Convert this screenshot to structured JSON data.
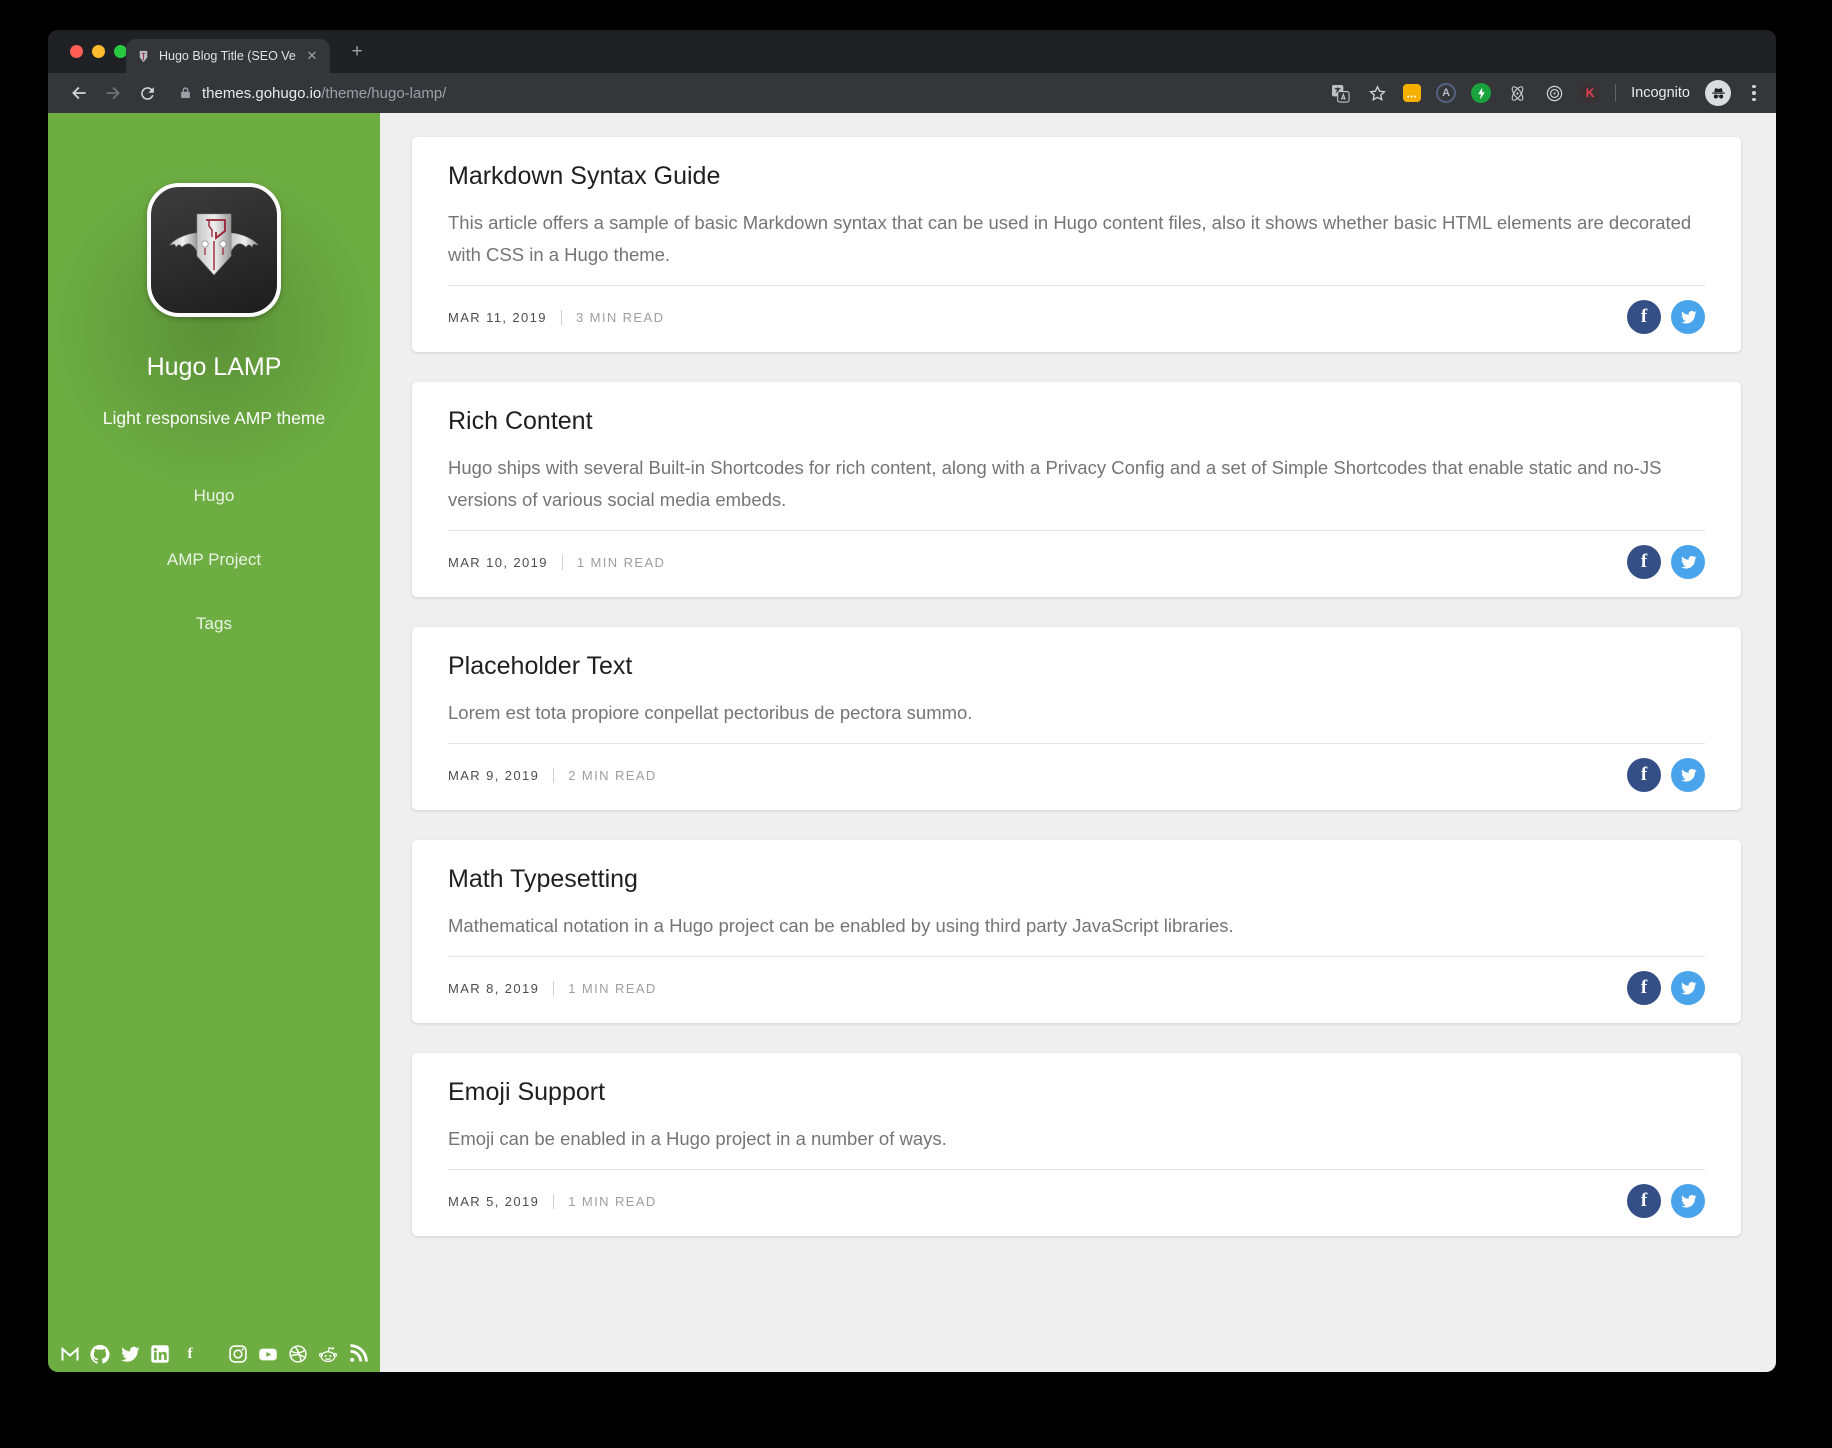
{
  "browser": {
    "tab_title": "Hugo Blog Title (SEO Version)",
    "url_host": "themes.gohugo.io",
    "url_path": "/theme/hugo-lamp/",
    "incognito_label": "Incognito",
    "extension_a_label": "A",
    "extension_k_label": "K"
  },
  "sidebar": {
    "title": "Hugo LAMP",
    "tagline": "Light responsive AMP theme",
    "nav": [
      {
        "label": "Hugo"
      },
      {
        "label": "AMP Project"
      },
      {
        "label": "Tags"
      }
    ],
    "social_icons": [
      "email",
      "github",
      "twitter",
      "linkedin",
      "facebook",
      "instagram",
      "youtube",
      "dribbble",
      "reddit",
      "rss"
    ]
  },
  "posts": [
    {
      "title": "Markdown Syntax Guide",
      "excerpt": "This article offers a sample of basic Markdown syntax that can be used in Hugo content files, also it shows whether basic HTML elements are decorated with CSS in a Hugo theme.",
      "date": "MAR 11, 2019",
      "read_time": "3 MIN READ"
    },
    {
      "title": "Rich Content",
      "excerpt": "Hugo ships with several Built-in Shortcodes for rich content, along with a Privacy Config and a set of Simple Shortcodes that enable static and no-JS versions of various social media embeds.",
      "date": "MAR 10, 2019",
      "read_time": "1 MIN READ"
    },
    {
      "title": "Placeholder Text",
      "excerpt": "Lorem est tota propiore conpellat pectoribus de pectora summo.",
      "date": "MAR 9, 2019",
      "read_time": "2 MIN READ"
    },
    {
      "title": "Math Typesetting",
      "excerpt": "Mathematical notation in a Hugo project can be enabled by using third party JavaScript libraries.",
      "date": "MAR 8, 2019",
      "read_time": "1 MIN READ"
    },
    {
      "title": "Emoji Support",
      "excerpt": "Emoji can be enabled in a Hugo project in a number of ways.",
      "date": "MAR 5, 2019",
      "read_time": "1 MIN READ"
    }
  ],
  "fb_glyph": "f",
  "theme": {
    "sidebar_green": "#6dad42",
    "content_bg": "#efefef",
    "facebook_blue": "#344e86",
    "twitter_blue": "#4aa4ec"
  }
}
